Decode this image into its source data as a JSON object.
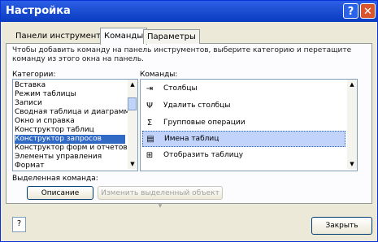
{
  "window": {
    "title": "Настройка"
  },
  "titlebar": {
    "help_icon": "?",
    "close_icon": "✕"
  },
  "tabs": [
    {
      "label": "Панели инструментов"
    },
    {
      "label": "Команды"
    },
    {
      "label": "Параметры"
    }
  ],
  "instruction": "Чтобы добавить команду на панель инструментов, выберите категорию и перетащите команду из этого окна на панель.",
  "categories": {
    "label": "Категории:",
    "items": [
      {
        "label": "Вставка",
        "selected": false
      },
      {
        "label": "Режим таблицы",
        "selected": false
      },
      {
        "label": "Записи",
        "selected": false
      },
      {
        "label": "Сводная таблица и диаграмма",
        "selected": false
      },
      {
        "label": "Окно и справка",
        "selected": false
      },
      {
        "label": "Конструктор таблиц",
        "selected": false
      },
      {
        "label": "Конструктор запросов",
        "selected": true
      },
      {
        "label": "Конструктор форм и отчетов",
        "selected": false
      },
      {
        "label": "Элементы управления",
        "selected": false
      },
      {
        "label": "Формат",
        "selected": false
      }
    ]
  },
  "commands": {
    "label": "Команды:",
    "items": [
      {
        "label": "Столбцы",
        "icon": "insert-columns-icon",
        "glyph": "⇥",
        "selected": false
      },
      {
        "label": "Удалить столбцы",
        "icon": "delete-columns-icon",
        "glyph": "Ψ",
        "selected": false
      },
      {
        "label": "Групповые операции",
        "icon": "sigma-icon",
        "glyph": "Σ",
        "selected": false
      },
      {
        "label": "Имена таблиц",
        "icon": "table-names-icon",
        "glyph": "▤",
        "selected": true
      },
      {
        "label": "Отобразить таблицу",
        "icon": "show-table-icon",
        "glyph": "⊞",
        "selected": false
      }
    ]
  },
  "selected_command": {
    "label": "Выделенная команда:",
    "description_button": "Описание",
    "modify_button": "Изменить выделенный объект ▾"
  },
  "footer": {
    "help_icon": "?",
    "close_button": "Закрыть"
  },
  "scroll": {
    "up": "▲",
    "down": "▼"
  },
  "colors": {
    "titlebar": "#0a3cc2",
    "selection": "#316ac5"
  }
}
